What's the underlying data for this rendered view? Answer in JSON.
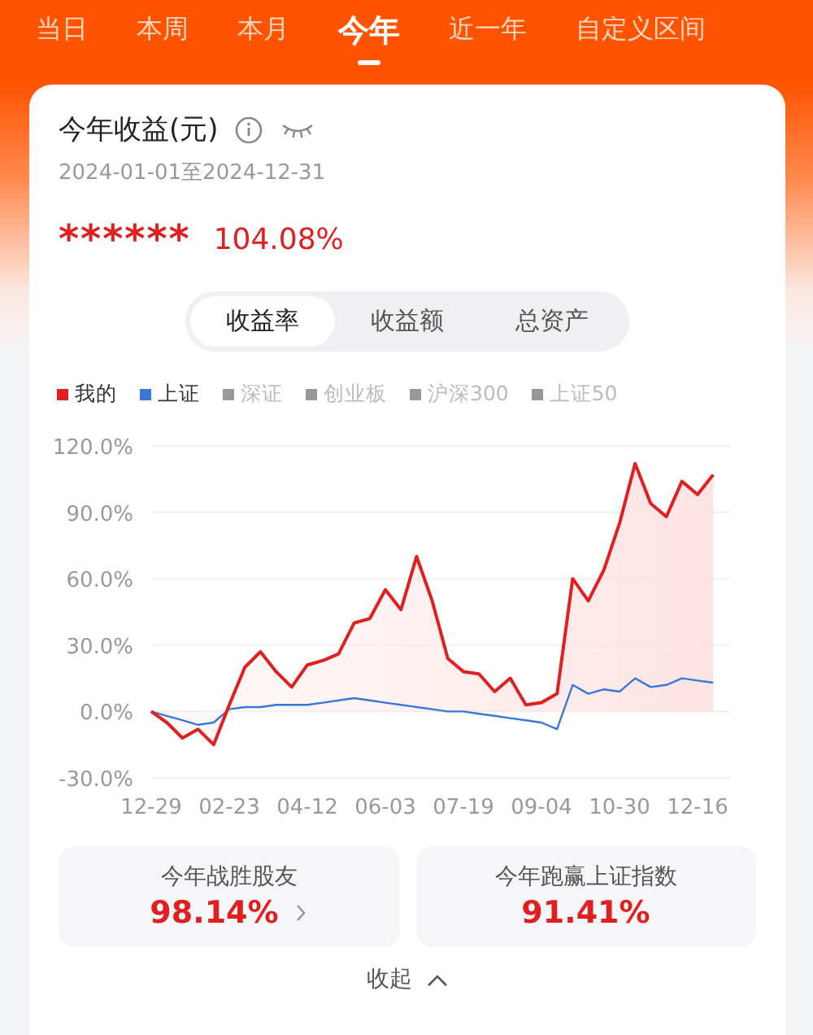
{
  "tabs": [
    {
      "label": "当日",
      "selected": false
    },
    {
      "label": "本周",
      "selected": false
    },
    {
      "label": "本月",
      "selected": false
    },
    {
      "label": "今年",
      "selected": true
    },
    {
      "label": "近一年",
      "selected": false
    },
    {
      "label": "自定义区间",
      "selected": false
    }
  ],
  "card": {
    "title": "今年收益(元)",
    "date_range": "2024-01-01至2024-12-31",
    "amount": "******",
    "return": "104.08%"
  },
  "segments": [
    {
      "label": "收益率",
      "selected": true
    },
    {
      "label": "收益额",
      "selected": false
    },
    {
      "label": "总资产",
      "selected": false
    }
  ],
  "legend": [
    {
      "label": "深证",
      "on": false,
      "color": "#999999"
    },
    {
      "label": "创业板",
      "on": false,
      "color": "#999999"
    },
    {
      "label": "沪深300",
      "on": false,
      "color": "#999999"
    },
    {
      "label": "上证50",
      "on": false,
      "color": "#999999"
    }
  ],
  "chart_data": {
    "type": "area",
    "categories": [
      "12-29",
      null,
      null,
      null,
      null,
      "02-23",
      null,
      null,
      null,
      null,
      "04-12",
      null,
      null,
      null,
      null,
      "06-03",
      null,
      null,
      null,
      null,
      "07-19",
      null,
      null,
      null,
      null,
      "09-04",
      null,
      null,
      null,
      null,
      "10-30",
      null,
      null,
      null,
      null,
      "12-16",
      null
    ],
    "ylim": [
      -30,
      120
    ],
    "grid": true,
    "yticks": [
      {
        "value": -30,
        "label": "-30.0%"
      },
      {
        "value": 0,
        "label": "0.0%"
      },
      {
        "value": 30,
        "label": "30.0%"
      },
      {
        "value": 60,
        "label": "60.0%"
      },
      {
        "value": 90,
        "label": "90.0%"
      },
      {
        "value": 120,
        "label": "120.0%"
      }
    ],
    "series": [
      {
        "name": "我的",
        "color": "#e02020",
        "values": [
          0,
          -5,
          -12,
          -8,
          -15,
          3,
          20,
          27,
          18,
          11,
          21,
          23,
          26,
          40,
          42,
          55,
          46,
          70,
          50,
          24,
          18,
          17,
          9,
          15,
          3,
          4,
          8,
          60,
          50,
          64,
          85,
          112,
          94,
          88,
          104,
          98,
          107
        ]
      },
      {
        "name": "上证",
        "color": "#3a78d8",
        "type": "line",
        "values": [
          0,
          -2,
          -4,
          -6,
          -5,
          1,
          2,
          2,
          3,
          3,
          3,
          4,
          5,
          6,
          5,
          4,
          3,
          2,
          1,
          0,
          0,
          -1,
          -2,
          -3,
          -4,
          -5,
          -8,
          12,
          8,
          10,
          9,
          15,
          11,
          12,
          15,
          14,
          13
        ]
      }
    ]
  },
  "stats": [
    {
      "label": "今年战胜股友",
      "value": "98.14%",
      "link": true
    },
    {
      "label": "今年跑赢上证指数",
      "value": "91.41%",
      "link": false
    }
  ],
  "collapse": "收起"
}
